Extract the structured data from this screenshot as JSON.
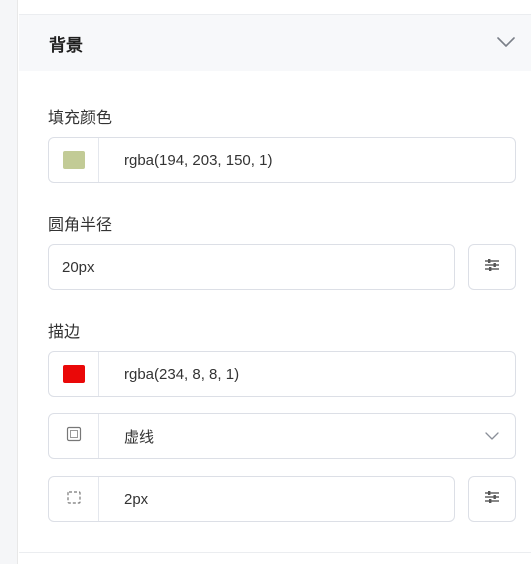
{
  "section": {
    "title": "背景"
  },
  "fill": {
    "label": "填充颜色",
    "color_text": "rgba(194, 203, 150, 1)",
    "swatch_color": "#c2cb96"
  },
  "radius": {
    "label": "圆角半径",
    "value": "20px"
  },
  "stroke": {
    "label": "描边",
    "color_text": "rgba(234, 8, 8, 1)",
    "swatch_color": "#ea0808",
    "style_value": "虚线",
    "width_value": "2px"
  },
  "icons": {
    "collapse": "chevron-up-icon",
    "dropdown": "chevron-down-icon",
    "adjust": "sliders-icon",
    "border_style": "square-outline-icon",
    "border_width": "dashed-square-icon"
  }
}
